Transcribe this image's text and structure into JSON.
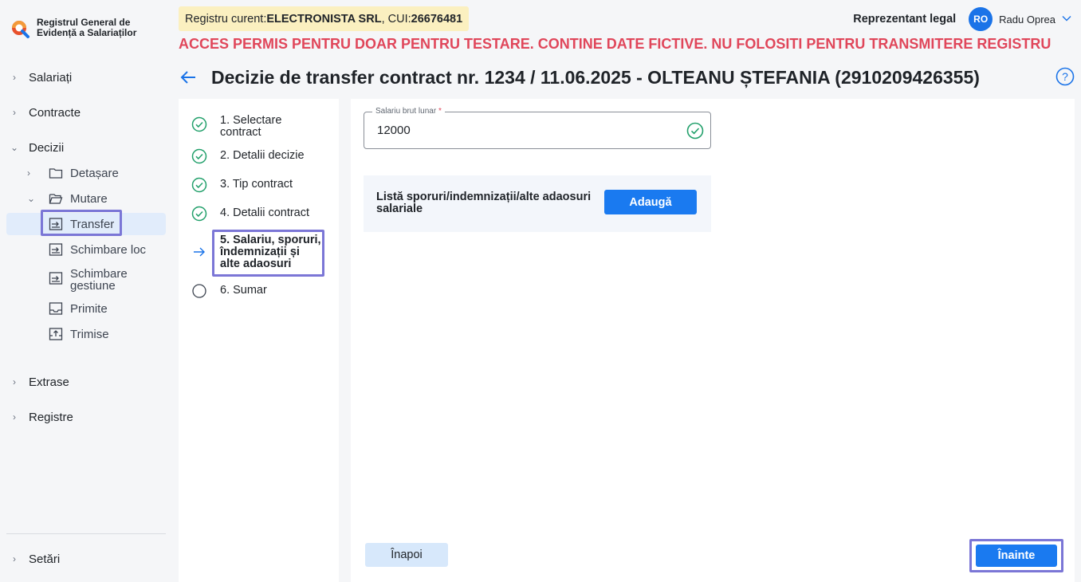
{
  "app": {
    "logo_text": "Registrul General de Evidență a Salariaților"
  },
  "sidebar": {
    "items": [
      {
        "label": "Salariați"
      },
      {
        "label": "Contracte"
      },
      {
        "label": "Decizii"
      },
      {
        "label": "Extrase"
      },
      {
        "label": "Registre"
      }
    ],
    "decizii_sub": [
      {
        "label": "Detașare"
      },
      {
        "label": "Mutare"
      },
      {
        "label": "Transfer"
      },
      {
        "label": "Schimbare loc"
      },
      {
        "label": "Schimbare gestiune"
      },
      {
        "label": "Primite"
      },
      {
        "label": "Trimise"
      }
    ],
    "settings": "Setări"
  },
  "header": {
    "registry_prefix": "Registru curent: ",
    "company": "ELECTRONISTA SRL",
    "cui_prefix": ", CUI: ",
    "cui": "26676481",
    "role": "Reprezentant legal",
    "avatar_initials": "RO",
    "user_name": "Radu Oprea",
    "warning": "ACCES PERMIS PENTRU DOAR PENTRU TESTARE. CONTINE DATE FICTIVE. NU FOLOSITI PENTRU TRANSMITERE REGISTRU",
    "page_title": "Decizie de transfer contract nr. 1234 / 11.06.2025 - OLTEANU  ȘTEFANIA (2910209426355)"
  },
  "steps": [
    {
      "label": "1. Selectare contract",
      "state": "done"
    },
    {
      "label": "2. Detalii decizie",
      "state": "done"
    },
    {
      "label": "3. Tip contract",
      "state": "done"
    },
    {
      "label": "4. Detalii contract",
      "state": "done"
    },
    {
      "label": "5. Salariu, sporuri, îndemnizații și alte adaosuri",
      "state": "current"
    },
    {
      "label": "6. Sumar",
      "state": "todo"
    }
  ],
  "form": {
    "salary_label": "Salariu brut lunar",
    "required_mark": "*",
    "salary_value": "12000",
    "bonus_label": "Listă sporuri/indemnizații/alte adaosuri salariale",
    "add_button": "Adaugă",
    "back_button": "Înapoi",
    "next_button": "Înainte"
  },
  "colors": {
    "accent": "#1a7af0",
    "success": "#22a06b",
    "warning": "#e0465a",
    "highlight": "#7b76d6"
  }
}
